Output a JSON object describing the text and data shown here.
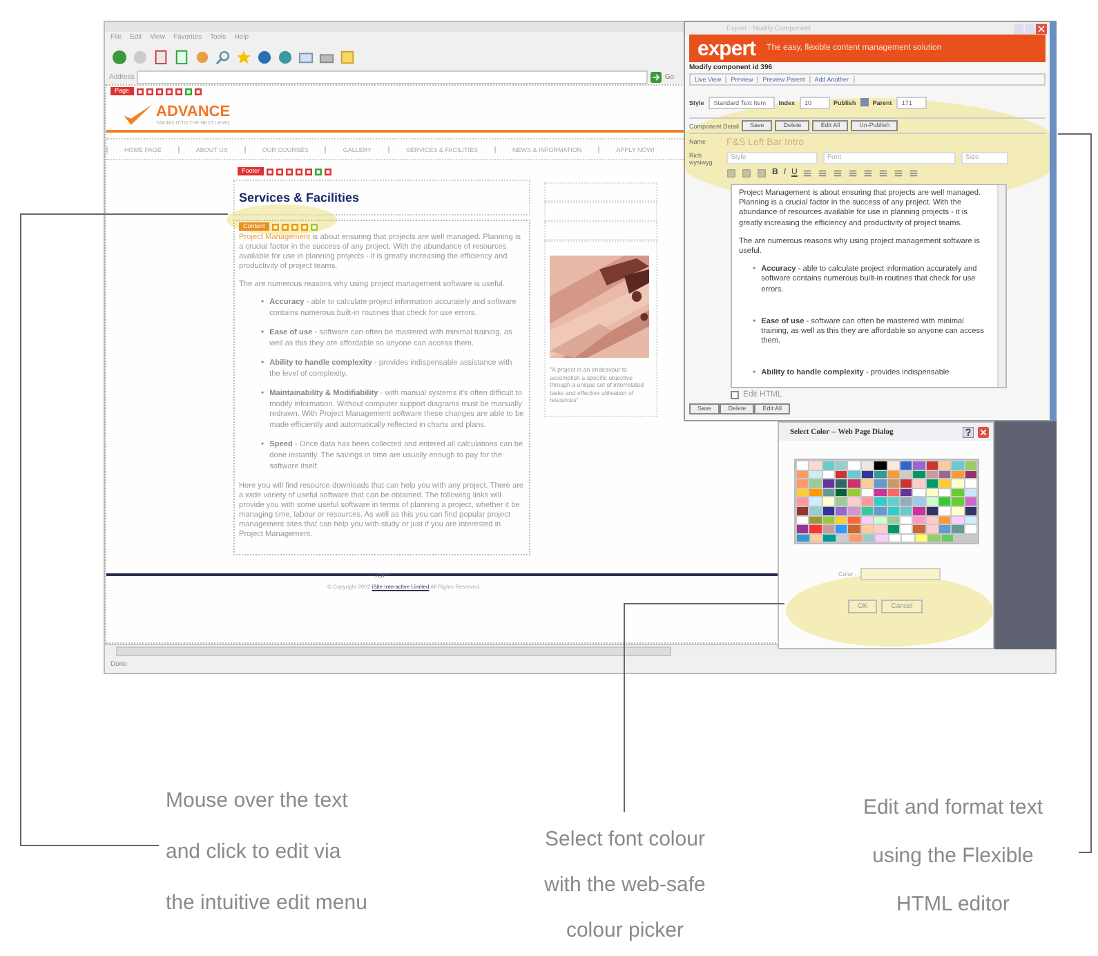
{
  "browser": {
    "menu": [
      "File",
      "Edit",
      "View",
      "Favorites",
      "Tools",
      "Help"
    ],
    "address_label": "Address",
    "go_label": "Go",
    "status": "Done",
    "page": {
      "page_tag": "Page",
      "logo": "ADVANCE",
      "tagline": "TAKING IT TO THE NEXT LEVEL",
      "bullet_mark": "•",
      "nav": [
        "HOME PAGE",
        "ABOUT US",
        "OUR COURSES",
        "GALLERY",
        "SERVICES & FACILITIES",
        "NEWS & INFORMATION",
        "APPLY NOW!"
      ],
      "footer_tag": "Footer",
      "heading": "Services & Facilities",
      "content_tag": "Content",
      "intro_lead": "Project Management",
      "intro": " is about ensuring that projects are well managed. Planning is a crucial factor in the success of any project. With the abundance of resources available for use in planning projects - it is greatly increasing the efficiency and productivity of project teams.",
      "reasons": "The are numerous reasons why using project management software is useful.",
      "bullets": [
        "**Accuracy** - able to calculate project information accurately and software contains numerous built-in routines that check for use errors.",
        "**Ease of use** - software can often be mastered with minimal training, as well as this they are affordable so anyone can access them.",
        "**Ability to handle complexity** - provides indispensable assistance with the level of complexity.",
        "**Maintainability & Modifiability** - with manual systems it's often difficult to modify information. Without computer support diagrams must be manually redrawn. With Project Management software these changes are able to be made efficiently and automatically reflected in charts and plans.",
        "**Speed** - Once data has been collected and entered all calculations can be done instantly. The savings in time are usually enough to pay for the software itself."
      ],
      "closing": "Here you will find resource downloads that can help you with any project. There are a wide variety of useful software that can be obtained. The following links will provide you with some useful software in terms of planning a project, whether it be managing time, labour or resources. As well as this you can find popular project management sites that can help you with study or just if you are interested in Project Management.",
      "quote": "\"A project is an endeavour to accomplish a specific objective through a unique set of interrelated tasks and effective utilisation of resources\"",
      "top_link": "TOP^",
      "copyright": "© Copyright 2002",
      "copyright_link": "iSite Interactive Limited",
      "rights": "All Rights Reserved."
    }
  },
  "editor": {
    "title": "Expert - Modify Component",
    "logo": "expert",
    "tagline": "The easy, flexible content management solution",
    "heading": "Modify component id 396",
    "links": [
      "Live View",
      "Preview",
      "Preview Parent",
      "Add Another"
    ],
    "style_label": "Style",
    "style_value": "Standard Text Item",
    "index_label": "Index",
    "index_value": "10",
    "publish_label": "Publish",
    "publish_checked": true,
    "parent_label": "Parent",
    "parent_value": "171",
    "tab_label": "Component Detail",
    "tab_buttons": [
      "Save",
      "Delete",
      "Edit All",
      "Un-Publish"
    ],
    "name_label": "Name",
    "name_value": "F&S Left Bar Intro",
    "rich_label": "Rich wysiwyg",
    "selects": [
      "Style",
      "Font",
      "Size"
    ],
    "format_buttons": [
      "B",
      "I",
      "U"
    ],
    "body": [
      "Project Management is about ensuring that projects are well managed. Planning is a crucial factor in the success of any project. With the abundance of resources available for use in planning projects - it is greatly increasing the efficiency and productivity of project teams.",
      "The are numerous reasons why using project management software is useful."
    ],
    "bullet_mark": "•",
    "body_bullets": [
      "**Accuracy** - able to calculate project information accurately and software contains numerous built-in routines that check for use errors.",
      "**Ease of use** - software can often be mastered with minimal training, as well as this they are affordable so anyone can access them.",
      "**Ability to handle complexity** - provides indispensable"
    ],
    "edit_html_label": "Edit HTML",
    "edit_html_checked": false,
    "buttons": [
      "Save",
      "Delete",
      "Edit All"
    ]
  },
  "color_dialog": {
    "title": "Select Color -- Web Page Dialog",
    "palette": [
      [
        {
          "color": "#ffffff"
        },
        {
          "color": "#f9d9d0"
        },
        {
          "color": "#66cccc"
        },
        {
          "color": "#99cccc"
        },
        {
          "color": "#ffffff"
        },
        {
          "color": "#f2e6e0"
        },
        {
          "color": "#000000"
        },
        {
          "color": "#fde9d9"
        },
        {
          "color": "#3366cc"
        },
        {
          "color": "#9966cc"
        },
        {
          "color": "#cc3333"
        },
        {
          "color": "#ffcc99"
        },
        {
          "color": "#66cccc"
        },
        {
          "color": "#99cc66"
        }
      ],
      [
        {
          "color": "#ff9966"
        },
        {
          "color": "#cceeee"
        },
        {
          "color": "#ffffff"
        },
        {
          "color": "#cc3333"
        },
        {
          "color": "#66cccc"
        },
        {
          "color": "#333399"
        },
        {
          "color": "#339999"
        },
        {
          "color": "#ff9933"
        },
        {
          "color": "#cccccc"
        },
        {
          "color": "#009966"
        },
        {
          "color": "#cc9999"
        },
        {
          "color": "#996699"
        },
        {
          "color": "#ff9933"
        },
        {
          "color": "#993366"
        }
      ],
      [
        {
          "color": "#ff9966"
        },
        {
          "color": "#99cc99"
        },
        {
          "color": "#663399"
        },
        {
          "color": "#336666"
        },
        {
          "color": "#cc3366"
        },
        {
          "color": "#ffcc99"
        },
        {
          "color": "#6699cc"
        },
        {
          "color": "#cc9966"
        },
        {
          "color": "#cc3333"
        },
        {
          "color": "#ffcccc"
        },
        {
          "color": "#009966"
        },
        {
          "color": "#ffcc33"
        },
        {
          "color": "#ffffcc"
        },
        {
          "color": "#ffffff"
        }
      ],
      [
        {
          "color": "#ffcc33"
        },
        {
          "color": "#ff9900"
        },
        {
          "color": "#669999"
        },
        {
          "color": "#006633"
        },
        {
          "color": "#99cc33"
        },
        {
          "color": "#ffffff"
        },
        {
          "color": "#cc3399"
        },
        {
          "color": "#ff6666"
        },
        {
          "color": "#663399"
        },
        {
          "color": "#ffffff"
        },
        {
          "color": "#ffffcc"
        },
        {
          "color": "#ffffff"
        },
        {
          "color": "#66cc33"
        },
        {
          "color": "#cce6ff"
        }
      ],
      [
        {
          "color": "#ff9999"
        },
        {
          "color": "#cceeff"
        },
        {
          "color": "#ffffcc"
        },
        {
          "color": "#99cc99"
        },
        {
          "color": "#ffcccc"
        },
        {
          "color": "#ff9999"
        },
        {
          "color": "#33cccc"
        },
        {
          "color": "#66cccc"
        },
        {
          "color": "#99aabb"
        },
        {
          "color": "#99ccee"
        },
        {
          "color": "#ccffcc"
        },
        {
          "color": "#33cc33"
        },
        {
          "color": "#66cc33"
        },
        {
          "color": "#cc66cc"
        }
      ],
      [
        {
          "color": "#993333"
        },
        {
          "color": "#99cccc"
        },
        {
          "color": "#333399"
        },
        {
          "color": "#9966cc"
        },
        {
          "color": "#cc99cc"
        },
        {
          "color": "#33cc99"
        },
        {
          "color": "#6699cc"
        },
        {
          "color": "#33cccc"
        },
        {
          "color": "#66cccc"
        },
        {
          "color": "#cc3399"
        },
        {
          "color": "#333366"
        },
        {
          "color": "#ffffff"
        },
        {
          "color": "#ffffcc"
        },
        {
          "color": "#333366"
        }
      ],
      [
        {
          "color": "#ffffff"
        },
        {
          "color": "#999933"
        },
        {
          "color": "#99cc33"
        },
        {
          "color": "#ffcc33"
        },
        {
          "color": "#ff6633"
        },
        {
          "color": "#ffccff"
        },
        {
          "color": "#ccffcc"
        },
        {
          "color": "#99cc99"
        },
        {
          "color": "#ffffff"
        },
        {
          "color": "#ff99cc"
        },
        {
          "color": "#ffcccc"
        },
        {
          "color": "#ff9933"
        },
        {
          "color": "#ffccff"
        },
        {
          "color": "#cceeff"
        }
      ],
      [
        {
          "color": "#993399"
        },
        {
          "color": "#ff3333"
        },
        {
          "color": "#cc9999"
        },
        {
          "color": "#3399ff"
        },
        {
          "color": "#cc6633"
        },
        {
          "color": "#ffcc99"
        },
        {
          "color": "#ffcccc"
        },
        {
          "color": "#009966"
        },
        {
          "color": "#ffffff"
        },
        {
          "color": "#cc6633"
        },
        {
          "color": "#ffcccc"
        },
        {
          "color": "#6699cc"
        },
        {
          "color": "#669999"
        },
        {
          "color": "#ffffff"
        }
      ],
      [
        {
          "color": "#3399cc"
        },
        {
          "color": "#ffcc99"
        },
        {
          "color": "#009999"
        },
        {
          "color": "#cccccc"
        },
        {
          "color": "#ff9966"
        },
        {
          "color": "#99cccc"
        },
        {
          "color": "#ffccff"
        },
        {
          "color": "#ffffff"
        },
        {
          "color": "#ffffff"
        },
        {
          "color": "#ffff66"
        },
        {
          "color": "#99cc66"
        },
        {
          "color": "#66cc66"
        }
      ]
    ],
    "color_label": "Color :",
    "ok": "OK",
    "cancel": "Cancel"
  },
  "captions": [
    [
      "Mouse over the text",
      "and click to edit via",
      "the intuitive edit menu"
    ],
    [
      "Select font colour",
      "with the web-safe",
      "colour picker"
    ],
    [
      "Edit and format text",
      "using the Flexible",
      "HTML editor"
    ]
  ]
}
